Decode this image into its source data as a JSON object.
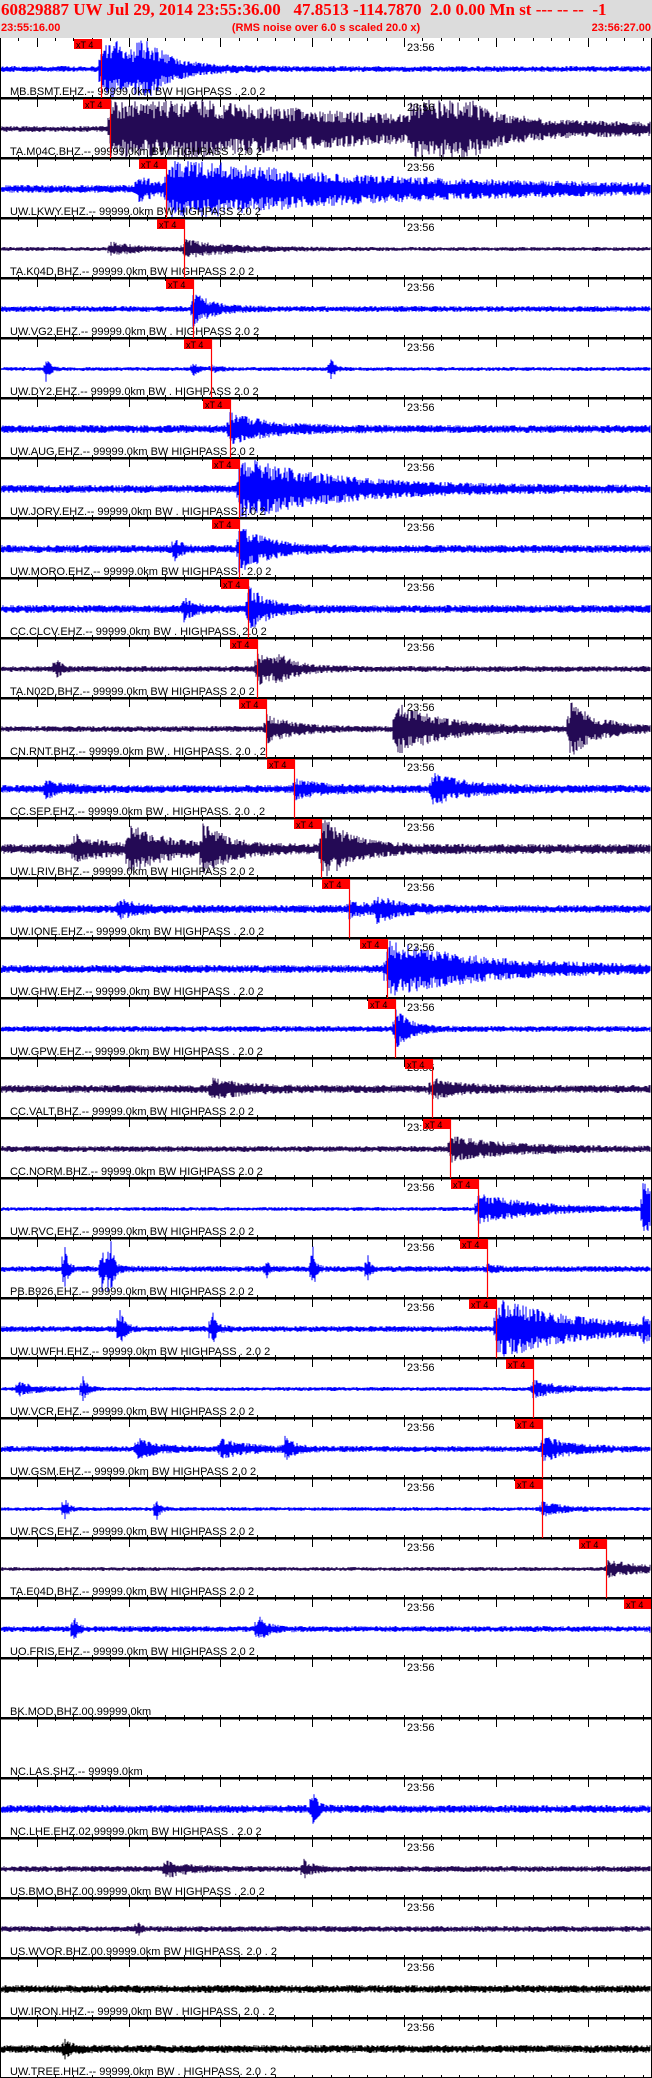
{
  "header": {
    "title": "60829887 UW Jul 29, 2014 23:55:36.00   47.8513 -114.7870  2.0 0.00 Mn st --- -- --  -1",
    "start_time": "23:55:16.00",
    "note": "(RMS noise over 6.0 s scaled 20.0 x)",
    "end_time": "23:56:27.00"
  },
  "time_axis": {
    "minute_label": "23:56",
    "window_seconds": 71,
    "minute_offset_s": 44
  },
  "colors": {
    "blue": "#0000ff",
    "purple": "#240a55",
    "black": "#000000",
    "pick": "#ff0000",
    "header_bg": "#dcdcdc"
  },
  "traces": [
    {
      "label": "MB.BSMT.EHZ.-- 99999.0km BW  HIGHPASS . 2.0  2",
      "color": "blue",
      "pick_label": "xT 4",
      "pick_offset_s": 11
    },
    {
      "label": "TA.M04C.BHZ.-- 99999.0km BW  HIGHPASS . 2.0  2",
      "color": "purple",
      "pick_label": "xT 4",
      "pick_offset_s": 12
    },
    {
      "label": "UW.LKWY.EHZ.-- 99999.0km BW  HIGHPASS  2.0  2",
      "color": "blue",
      "pick_label": "xT 4",
      "pick_offset_s": 18.1
    },
    {
      "label": "TA.K04D.BHZ.-- 99999.0km BW  HIGHPASS  2.0  2",
      "color": "purple",
      "pick_label": "xT 4",
      "pick_offset_s": 20
    },
    {
      "label": "UW.VG2.EHZ.-- 99999.0km BW . HIGHPASS  2.0  2",
      "color": "blue",
      "pick_label": "xT 4",
      "pick_offset_s": 21
    },
    {
      "label": "UW.DY2.EHZ.-- 99999.0km BW . HIGHPASS  2.0  2",
      "color": "blue",
      "pick_label": "xT 4",
      "pick_offset_s": 23
    },
    {
      "label": "UW.AUG.EHZ.-- 99999.0km BW  HIGHPASS  2.0  2",
      "color": "blue",
      "pick_label": "xT 4",
      "pick_offset_s": 25
    },
    {
      "label": "UW.JORV.EHZ.-- 99999.0km BW . HIGHPASS  2.0  2",
      "color": "blue",
      "pick_label": "xT 4",
      "pick_offset_s": 26
    },
    {
      "label": "UW.MORO.EHZ.-- 99999.0km BW  HIGHPASS . 2.0  2",
      "color": "blue",
      "pick_label": "xT 4",
      "pick_offset_s": 26
    },
    {
      "label": "CC.CLCV.EHZ.-- 99999.0km BW . HIGHPASS.  2.0  2",
      "color": "blue",
      "pick_label": "xT 4",
      "pick_offset_s": 27
    },
    {
      "label": "TA.N02D.BHZ.-- 99999.0km BW  HIGHPASS  2.0  2",
      "color": "purple",
      "pick_label": "xT 4",
      "pick_offset_s": 28
    },
    {
      "label": "CN.RNT.BHZ.-- 99999.0km BW . HIGHPASS.  2.0 . 2",
      "color": "purple",
      "pick_label": "xT 4",
      "pick_offset_s": 29
    },
    {
      "label": "CC.SEP.EHZ.-- 99999.0km BW . HIGHPASS.  2.0 . 2",
      "color": "blue",
      "pick_label": "xT 4",
      "pick_offset_s": 32
    },
    {
      "label": "UW.LRIV.BHZ.-- 99999.0km BW  HIGHPASS  2.0  2",
      "color": "purple",
      "pick_label": "xT 4",
      "pick_offset_s": 35
    },
    {
      "label": "UW.IONE.EHZ.-- 99999.0km BW  HIGHPASS . 2.0  2",
      "color": "blue",
      "pick_label": "xT 4",
      "pick_offset_s": 38
    },
    {
      "label": "UW.GHW.EHZ.-- 99999.0km BW  HIGHPASS . 2.0  2",
      "color": "blue",
      "pick_label": "xT 4",
      "pick_offset_s": 42.1
    },
    {
      "label": "UW.GPW.EHZ.-- 99999.0km BW  HIGHPASS . 2.0  2",
      "color": "blue",
      "pick_label": "xT 4",
      "pick_offset_s": 43
    },
    {
      "label": "CC.VALT.BHZ.-- 99999.0km BW  HIGHPASS  2.0  2",
      "color": "purple",
      "pick_label": "xT 4",
      "pick_offset_s": 47
    },
    {
      "label": "CC.NORM.BHZ.-- 99999.0km BW  HIGHPASS  2.0  2",
      "color": "purple",
      "pick_label": "xT 4",
      "pick_offset_s": 49
    },
    {
      "label": "UW.RVC.EHZ.-- 99999.0km BW  HIGHPASS  2.0  2",
      "color": "blue",
      "pick_label": "xT 4",
      "pick_offset_s": 52
    },
    {
      "label": "PB.B926.EHZ.-- 99999.0km BW  HIGHPASS  2.0  2",
      "color": "blue",
      "pick_label": "xT 4",
      "pick_offset_s": 53
    },
    {
      "label": "UW.UWFH.EHZ.-- 99999.0km BW  HIGHPASS . 2.0  2",
      "color": "blue",
      "pick_label": "xT 4",
      "pick_offset_s": 54
    },
    {
      "label": "UW.VCR.EHZ.-- 99999.0km BW  HIGHPASS  2.0  2",
      "color": "blue",
      "pick_label": "xT 4",
      "pick_offset_s": 58
    },
    {
      "label": "UW.GSM.EHZ.-- 99999.0km BW  HIGHPASS  2.0  2",
      "color": "blue",
      "pick_label": "xT 4",
      "pick_offset_s": 59
    },
    {
      "label": "UW.RCS.EHZ.-- 99999.0km BW  HIGHPASS  2.0  2",
      "color": "blue",
      "pick_label": "xT 4",
      "pick_offset_s": 59
    },
    {
      "label": "TA.E04D.BHZ.-- 99999.0km BW  HIGHPASS  2.0  2",
      "color": "purple",
      "pick_label": "xT 4",
      "pick_offset_s": 66
    },
    {
      "label": "UO.FRIS.EHZ.-- 99999.0km BW  HIGHPASS  2.0  2",
      "color": "blue",
      "pick_label": "xT 4",
      "pick_offset_s": 71
    },
    {
      "label": "BK.MOD.BHZ.00.99999.0km",
      "color": "blue"
    },
    {
      "label": "NC.LAS.SHZ.-- 99999.0km",
      "color": "blue"
    },
    {
      "label": "NC.LHE.EHZ.02.99999.0km BW  HIGHPASS . 2.0  2",
      "color": "blue"
    },
    {
      "label": "US.BMO.BHZ.00.99999.0km BW  HIGHPASS . 2.0  2",
      "color": "purple"
    },
    {
      "label": "US.WVOR.BHZ.00.99999.0km BW  HIGHPASS.  2.0 . 2",
      "color": "purple"
    },
    {
      "label": "UW.IRON.HHZ.-- 99999.0km BW . HIGHPASS.  2.0 . 2",
      "color": "black"
    },
    {
      "label": "UW.TREE.HHZ.-- 99999.0km BW . HIGHPASS.  2.0 . 2",
      "color": "black"
    }
  ]
}
